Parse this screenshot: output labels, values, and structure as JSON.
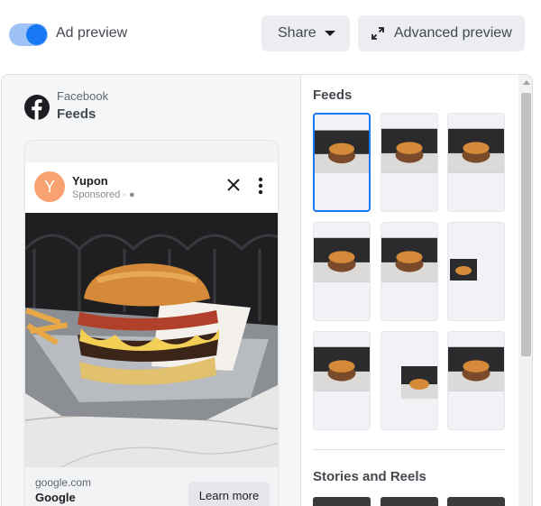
{
  "topbar": {
    "toggle_label": "Ad preview",
    "toggle_on": true,
    "share_label": "Share",
    "advanced_label": "Advanced preview"
  },
  "placement": {
    "app": "Facebook",
    "name": "Feeds"
  },
  "ad": {
    "avatar_letter": "Y",
    "page_name": "Yupon",
    "sponsored": "Sponsored ·",
    "domain": "google.com",
    "headline": "Google",
    "cta": "Learn more"
  },
  "placements_panel": {
    "feeds_title": "Feeds",
    "stories_title": "Stories and Reels"
  },
  "colors": {
    "accent": "#1877f2",
    "avatar": "#f7a26f"
  }
}
